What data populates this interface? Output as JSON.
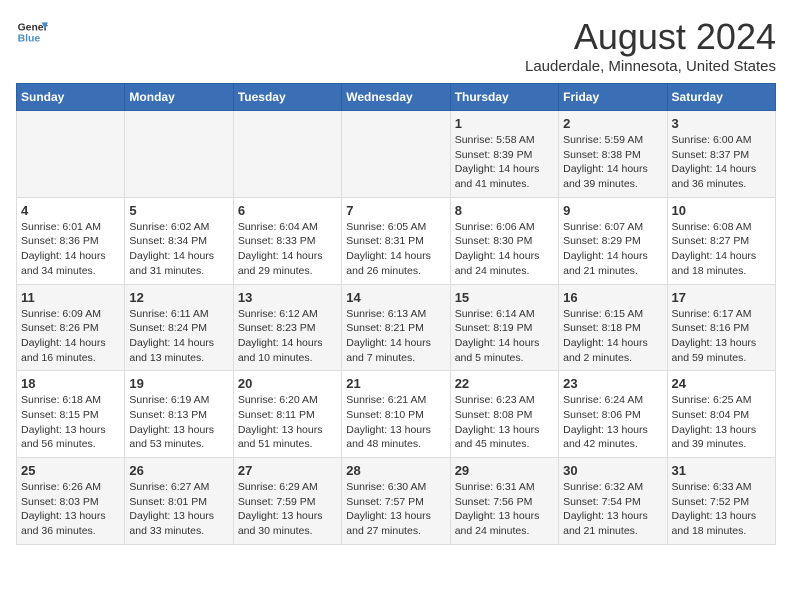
{
  "header": {
    "logo_line1": "General",
    "logo_line2": "Blue",
    "month_year": "August 2024",
    "location": "Lauderdale, Minnesota, United States"
  },
  "days_of_week": [
    "Sunday",
    "Monday",
    "Tuesday",
    "Wednesday",
    "Thursday",
    "Friday",
    "Saturday"
  ],
  "weeks": [
    [
      {
        "day": "",
        "info": ""
      },
      {
        "day": "",
        "info": ""
      },
      {
        "day": "",
        "info": ""
      },
      {
        "day": "",
        "info": ""
      },
      {
        "day": "1",
        "info": "Sunrise: 5:58 AM\nSunset: 8:39 PM\nDaylight: 14 hours\nand 41 minutes."
      },
      {
        "day": "2",
        "info": "Sunrise: 5:59 AM\nSunset: 8:38 PM\nDaylight: 14 hours\nand 39 minutes."
      },
      {
        "day": "3",
        "info": "Sunrise: 6:00 AM\nSunset: 8:37 PM\nDaylight: 14 hours\nand 36 minutes."
      }
    ],
    [
      {
        "day": "4",
        "info": "Sunrise: 6:01 AM\nSunset: 8:36 PM\nDaylight: 14 hours\nand 34 minutes."
      },
      {
        "day": "5",
        "info": "Sunrise: 6:02 AM\nSunset: 8:34 PM\nDaylight: 14 hours\nand 31 minutes."
      },
      {
        "day": "6",
        "info": "Sunrise: 6:04 AM\nSunset: 8:33 PM\nDaylight: 14 hours\nand 29 minutes."
      },
      {
        "day": "7",
        "info": "Sunrise: 6:05 AM\nSunset: 8:31 PM\nDaylight: 14 hours\nand 26 minutes."
      },
      {
        "day": "8",
        "info": "Sunrise: 6:06 AM\nSunset: 8:30 PM\nDaylight: 14 hours\nand 24 minutes."
      },
      {
        "day": "9",
        "info": "Sunrise: 6:07 AM\nSunset: 8:29 PM\nDaylight: 14 hours\nand 21 minutes."
      },
      {
        "day": "10",
        "info": "Sunrise: 6:08 AM\nSunset: 8:27 PM\nDaylight: 14 hours\nand 18 minutes."
      }
    ],
    [
      {
        "day": "11",
        "info": "Sunrise: 6:09 AM\nSunset: 8:26 PM\nDaylight: 14 hours\nand 16 minutes."
      },
      {
        "day": "12",
        "info": "Sunrise: 6:11 AM\nSunset: 8:24 PM\nDaylight: 14 hours\nand 13 minutes."
      },
      {
        "day": "13",
        "info": "Sunrise: 6:12 AM\nSunset: 8:23 PM\nDaylight: 14 hours\nand 10 minutes."
      },
      {
        "day": "14",
        "info": "Sunrise: 6:13 AM\nSunset: 8:21 PM\nDaylight: 14 hours\nand 7 minutes."
      },
      {
        "day": "15",
        "info": "Sunrise: 6:14 AM\nSunset: 8:19 PM\nDaylight: 14 hours\nand 5 minutes."
      },
      {
        "day": "16",
        "info": "Sunrise: 6:15 AM\nSunset: 8:18 PM\nDaylight: 14 hours\nand 2 minutes."
      },
      {
        "day": "17",
        "info": "Sunrise: 6:17 AM\nSunset: 8:16 PM\nDaylight: 13 hours\nand 59 minutes."
      }
    ],
    [
      {
        "day": "18",
        "info": "Sunrise: 6:18 AM\nSunset: 8:15 PM\nDaylight: 13 hours\nand 56 minutes."
      },
      {
        "day": "19",
        "info": "Sunrise: 6:19 AM\nSunset: 8:13 PM\nDaylight: 13 hours\nand 53 minutes."
      },
      {
        "day": "20",
        "info": "Sunrise: 6:20 AM\nSunset: 8:11 PM\nDaylight: 13 hours\nand 51 minutes."
      },
      {
        "day": "21",
        "info": "Sunrise: 6:21 AM\nSunset: 8:10 PM\nDaylight: 13 hours\nand 48 minutes."
      },
      {
        "day": "22",
        "info": "Sunrise: 6:23 AM\nSunset: 8:08 PM\nDaylight: 13 hours\nand 45 minutes."
      },
      {
        "day": "23",
        "info": "Sunrise: 6:24 AM\nSunset: 8:06 PM\nDaylight: 13 hours\nand 42 minutes."
      },
      {
        "day": "24",
        "info": "Sunrise: 6:25 AM\nSunset: 8:04 PM\nDaylight: 13 hours\nand 39 minutes."
      }
    ],
    [
      {
        "day": "25",
        "info": "Sunrise: 6:26 AM\nSunset: 8:03 PM\nDaylight: 13 hours\nand 36 minutes."
      },
      {
        "day": "26",
        "info": "Sunrise: 6:27 AM\nSunset: 8:01 PM\nDaylight: 13 hours\nand 33 minutes."
      },
      {
        "day": "27",
        "info": "Sunrise: 6:29 AM\nSunset: 7:59 PM\nDaylight: 13 hours\nand 30 minutes."
      },
      {
        "day": "28",
        "info": "Sunrise: 6:30 AM\nSunset: 7:57 PM\nDaylight: 13 hours\nand 27 minutes."
      },
      {
        "day": "29",
        "info": "Sunrise: 6:31 AM\nSunset: 7:56 PM\nDaylight: 13 hours\nand 24 minutes."
      },
      {
        "day": "30",
        "info": "Sunrise: 6:32 AM\nSunset: 7:54 PM\nDaylight: 13 hours\nand 21 minutes."
      },
      {
        "day": "31",
        "info": "Sunrise: 6:33 AM\nSunset: 7:52 PM\nDaylight: 13 hours\nand 18 minutes."
      }
    ]
  ]
}
